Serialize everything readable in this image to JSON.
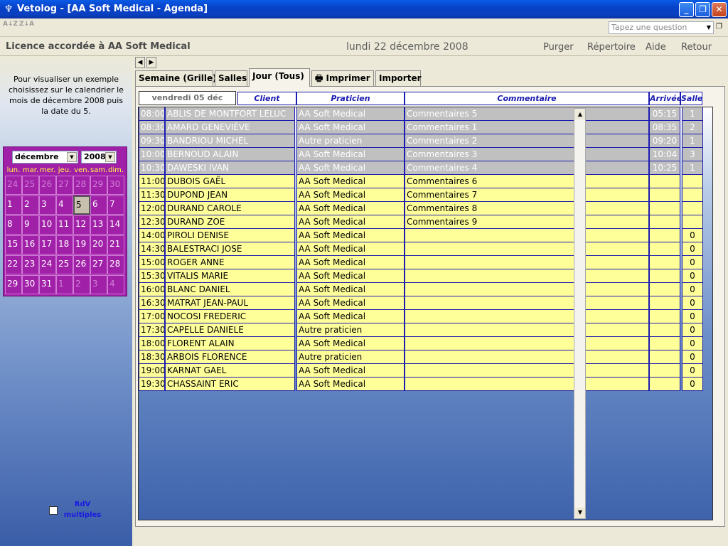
{
  "window": {
    "title": "Vetolog - [AA Soft Medical - Agenda]",
    "minimize": "_",
    "restore": "❐",
    "close": "✕"
  },
  "toolbar": {
    "sort_asc": "A↓Z",
    "sort_desc": "Z↓A",
    "question_placeholder": "Tapez une question"
  },
  "header": {
    "license": "Licence accordée à  AA Soft Medical",
    "date": "lundi 22 décembre 2008",
    "menu": [
      "Purger",
      "Répertoire",
      "Aide",
      "Retour"
    ]
  },
  "sidebar": {
    "hint": "Pour visualiser un exemple choisissez sur le calendrier le mois de décembre  2008 puis la date du 5.",
    "month": "décembre",
    "year": "2008",
    "weekdays": [
      "lun.",
      "mar.",
      "mer.",
      "jeu.",
      "ven.",
      "sam.",
      "dim."
    ],
    "weeks": [
      [
        "24",
        "25",
        "26",
        "27",
        "28",
        "29",
        "30"
      ],
      [
        "1",
        "2",
        "3",
        "4",
        "5",
        "6",
        "7"
      ],
      [
        "8",
        "9",
        "10",
        "11",
        "12",
        "13",
        "14"
      ],
      [
        "15",
        "16",
        "17",
        "18",
        "19",
        "20",
        "21"
      ],
      [
        "22",
        "23",
        "24",
        "25",
        "26",
        "27",
        "28"
      ],
      [
        "29",
        "30",
        "31",
        "1",
        "2",
        "3",
        "4"
      ]
    ],
    "multi_label": "RdV multiples"
  },
  "tabs": [
    {
      "label": "Semaine (Grille)"
    },
    {
      "label": "Salles"
    },
    {
      "label": "Jour (Tous)"
    },
    {
      "label": "Imprimer"
    },
    {
      "label": "Importer"
    }
  ],
  "grid": {
    "date_header": "vendredi 05 déc",
    "columns": [
      "Client",
      "Praticien",
      "Commentaire",
      "Arrivée",
      "Salle"
    ],
    "rows": [
      {
        "time": "08:00",
        "client": "ABLIS DE MONTFORT LELUC",
        "prat": "AA Soft Medical",
        "comment": "Commentaires 5",
        "arrival": "05:15",
        "room": "1",
        "state": "done"
      },
      {
        "time": "08:30",
        "client": "AMARD GENEVIÈVE",
        "prat": "AA Soft Medical",
        "comment": "Commentaires 1",
        "arrival": "08:35",
        "room": "2",
        "state": "done"
      },
      {
        "time": "09:30",
        "client": "BANDRIOU MICHEL",
        "prat": "Autre praticien",
        "comment": "Commentaires 2",
        "arrival": "09:20",
        "room": "1",
        "state": "done"
      },
      {
        "time": "10:00",
        "client": "BERNOUD ALAIN",
        "prat": "AA Soft Medical",
        "comment": "Commentaires 3",
        "arrival": "10:04",
        "room": "3",
        "state": "done"
      },
      {
        "time": "10:30",
        "client": "DAWESKI IVAN",
        "prat": "AA Soft Medical",
        "comment": "Commentaires 4",
        "arrival": "10:25",
        "room": "1",
        "state": "done"
      },
      {
        "time": "11:00",
        "client": "DUBOIS GAËL",
        "prat": "AA Soft Medical",
        "comment": "Commentaires 6",
        "arrival": "",
        "room": "",
        "state": "pending"
      },
      {
        "time": "11:30",
        "client": "DUPOND JEAN",
        "prat": "AA Soft Medical",
        "comment": "Commentaires 7",
        "arrival": "",
        "room": "",
        "state": "pending"
      },
      {
        "time": "12:00",
        "client": "DURAND CAROLE",
        "prat": "AA Soft Medical",
        "comment": "Commentaires 8",
        "arrival": "",
        "room": "",
        "state": "pending"
      },
      {
        "time": "12:30",
        "client": "DURAND ZOE",
        "prat": "AA Soft Medical",
        "comment": "Commentaires 9",
        "arrival": "",
        "room": "",
        "state": "pending"
      },
      {
        "time": "14:00",
        "client": "PIROLI DENISE",
        "prat": "AA Soft Medical",
        "comment": "",
        "arrival": "",
        "room": "0",
        "state": "pending"
      },
      {
        "time": "14:30",
        "client": "BALESTRACI JOSE",
        "prat": "AA Soft Medical",
        "comment": "",
        "arrival": "",
        "room": "0",
        "state": "pending"
      },
      {
        "time": "15:00",
        "client": "ROGER ANNE",
        "prat": "AA Soft Medical",
        "comment": "",
        "arrival": "",
        "room": "0",
        "state": "pending"
      },
      {
        "time": "15:30",
        "client": "VITALIS MARIE",
        "prat": "AA Soft Medical",
        "comment": "",
        "arrival": "",
        "room": "0",
        "state": "pending"
      },
      {
        "time": "16:00",
        "client": "BLANC DANIEL",
        "prat": "AA Soft Medical",
        "comment": "",
        "arrival": "",
        "room": "0",
        "state": "pending"
      },
      {
        "time": "16:30",
        "client": "MATRAT JEAN-PAUL",
        "prat": "AA Soft Medical",
        "comment": "",
        "arrival": "",
        "room": "0",
        "state": "pending"
      },
      {
        "time": "17:00",
        "client": "NOCOSI FREDERIC",
        "prat": "AA Soft Medical",
        "comment": "",
        "arrival": "",
        "room": "0",
        "state": "pending"
      },
      {
        "time": "17:30",
        "client": "CAPELLE DANIELE",
        "prat": "Autre praticien",
        "comment": "",
        "arrival": "",
        "room": "0",
        "state": "pending"
      },
      {
        "time": "18:00",
        "client": "FLORENT ALAIN",
        "prat": "AA Soft Medical",
        "comment": "",
        "arrival": "",
        "room": "0",
        "state": "pending"
      },
      {
        "time": "18:30",
        "client": "ARBOIS FLORENCE",
        "prat": "Autre praticien",
        "comment": "",
        "arrival": "",
        "room": "0",
        "state": "pending"
      },
      {
        "time": "19:00",
        "client": "KARNAT GAEL",
        "prat": "AA Soft Medical",
        "comment": "",
        "arrival": "",
        "room": "0",
        "state": "pending"
      },
      {
        "time": "19:30",
        "client": "CHASSAINT ERIC",
        "prat": "AA Soft Medical",
        "comment": "",
        "arrival": "",
        "room": "0",
        "state": "pending"
      }
    ]
  },
  "colors": {
    "done_row": "#c0c0c0",
    "pending_row": "#ffff9a",
    "calendar_bg": "#a020a8",
    "title_bar": "#0842c9"
  }
}
